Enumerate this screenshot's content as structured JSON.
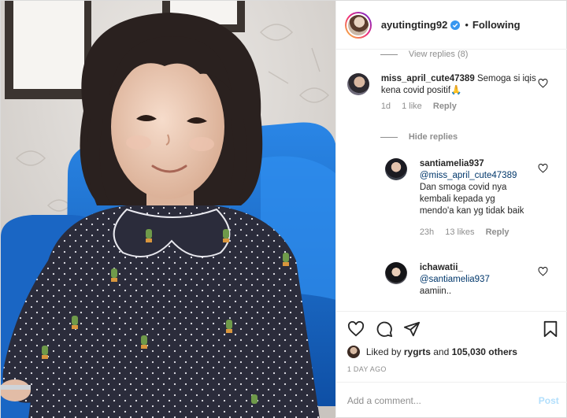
{
  "header": {
    "username": "ayutingting92",
    "separator": "•",
    "follow_label": "Following"
  },
  "comments": {
    "view_replies": "View replies (8)",
    "items": [
      {
        "username": "miss_april_cute47389",
        "text": "Semoga si iqis kena covid positif🙏",
        "time": "1d",
        "likes": "1 like",
        "reply": "Reply"
      }
    ],
    "hide_replies": "Hide replies",
    "replies": [
      {
        "username": "santiamelia937",
        "mention": "@miss_april_cute47389",
        "text": "Dan smoga covid nya kembali kepada yg mendo'a kan yg tidak baik",
        "time": "23h",
        "likes": "13 likes",
        "reply": "Reply"
      },
      {
        "username": "ichawatii_",
        "mention": "@santiamelia937",
        "text": "aamiin.."
      }
    ]
  },
  "likes": {
    "prefix": "Liked by",
    "user": "rygrts",
    "joiner": "and",
    "count": "105,030 others"
  },
  "date": "1 DAY AGO",
  "add_comment": {
    "placeholder": "Add a comment...",
    "post_label": "Post"
  },
  "icons": {
    "like": "heart-icon",
    "comment": "comment-icon",
    "share": "paper-plane-icon",
    "save": "bookmark-icon",
    "verified": "verified-badge-icon"
  },
  "colors": {
    "verified": "#3897f0",
    "mention": "#00376b",
    "muted": "#8e8e8e",
    "post_disabled": "#b2dffc",
    "sofa": "#1f6fce"
  }
}
